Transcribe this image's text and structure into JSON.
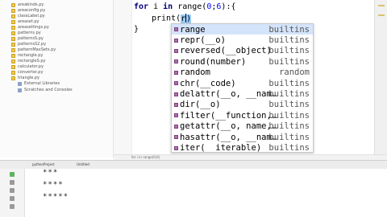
{
  "project_tree": {
    "files": [
      "areabinds.py",
      "areaconfig.py",
      "classLabel.py",
      "areaset.py",
      "areasettings.py",
      "patterns.py",
      "patternsS.py",
      "patternsS2.py",
      "patternMaxSets.py",
      "rectangle.py",
      "rectangleS.py",
      "calculator.py",
      "converter.py",
      "triangle.py"
    ],
    "external_libraries": "External Libraries",
    "scratches": "Scratches and Consoles"
  },
  "editor": {
    "line1": {
      "kw_for": "for",
      "var": " i ",
      "kw_in": "in",
      "call": " range(",
      "n1": "0",
      "sep": ";",
      "n2": "6",
      "end": "):{"
    },
    "line2": {
      "fn": "print(",
      "typed": "r"
    },
    "line3": "}",
    "status_hint": "for i in range(0;6)"
  },
  "completion": {
    "items": [
      {
        "name": "range",
        "hint": "builtins"
      },
      {
        "name": "repr(__o)",
        "hint": "builtins"
      },
      {
        "name": "reversed(__object)",
        "hint": "builtins"
      },
      {
        "name": "round(number)",
        "hint": "builtins"
      },
      {
        "name": "random",
        "hint": "random"
      },
      {
        "name": "chr(__code)",
        "hint": "builtins"
      },
      {
        "name": "delattr(__o, __nam…",
        "hint": "builtins"
      },
      {
        "name": "dir(__o)",
        "hint": "builtins"
      },
      {
        "name": "filter(__function,…",
        "hint": "builtins"
      },
      {
        "name": "getattr(__o, name,…",
        "hint": "builtins"
      },
      {
        "name": "hasattr(__o, __nam…",
        "hint": "builtins"
      },
      {
        "name": "iter(__iterable)",
        "hint": "builtins"
      }
    ],
    "icon_color": "#b06fb0",
    "selected_color": "#d4e4fb"
  },
  "run_panel": {
    "tabs": [
      "pythonProject",
      "Untitled"
    ],
    "output": [
      "***",
      "****",
      "*****"
    ]
  },
  "colors": {
    "keyword": "#000080",
    "number": "#0000ff",
    "paren_highlight": "#99ccff"
  }
}
